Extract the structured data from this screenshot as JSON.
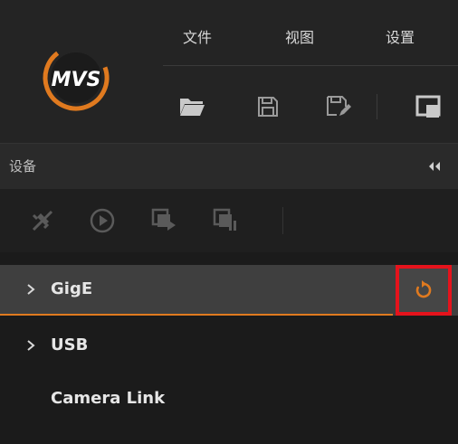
{
  "app": {
    "logo_text": "MVS",
    "accent_color": "#e07a1f",
    "highlight_color": "#e5131c"
  },
  "menubar": {
    "items": [
      {
        "label": "文件"
      },
      {
        "label": "视图"
      },
      {
        "label": "设置"
      }
    ]
  },
  "toolbar": {
    "buttons": [
      {
        "icon": "open-folder-icon"
      },
      {
        "icon": "save-icon"
      },
      {
        "icon": "save-as-icon"
      },
      {
        "icon": "window-icon"
      }
    ]
  },
  "device_panel": {
    "title": "设备",
    "collapse_icon": "double-chevron-left-icon",
    "toolbar": [
      {
        "icon": "disconnect-icon"
      },
      {
        "icon": "play-icon"
      },
      {
        "icon": "start-grab-icon"
      },
      {
        "icon": "stop-grab-icon"
      }
    ],
    "tree": [
      {
        "label": "GigE",
        "expandable": true,
        "selected": true
      },
      {
        "label": "USB",
        "expandable": true,
        "selected": false
      },
      {
        "label": "Camera Link",
        "expandable": false,
        "selected": false
      }
    ],
    "refresh_icon": "refresh-icon"
  }
}
